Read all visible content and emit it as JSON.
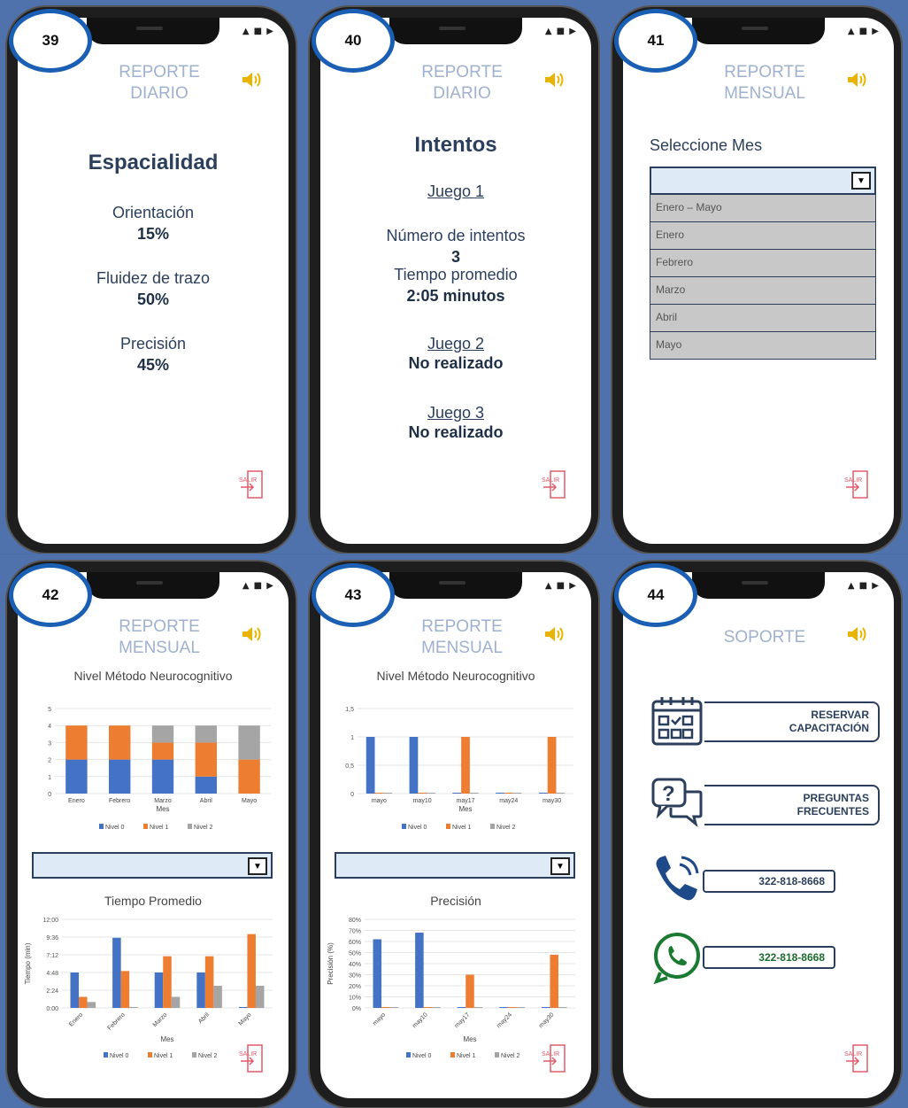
{
  "status_icons": "▲ ■ ▶",
  "panels": {
    "p39": {
      "number": "39",
      "title": "REPORTE DIARIO",
      "heading": "Espacialidad",
      "items": [
        {
          "label": "Orientación",
          "value": "15%"
        },
        {
          "label": "Fluidez de trazo",
          "value": "50%"
        },
        {
          "label": "Precisión",
          "value": "45%"
        }
      ]
    },
    "p40": {
      "number": "40",
      "title": "REPORTE DIARIO",
      "heading": "Intentos",
      "game1": "Juego 1",
      "attempts_label": "Número de intentos",
      "attempts_value": "3",
      "time_label": "Tiempo promedio",
      "time_value": "2:05 minutos",
      "game2": "Juego 2",
      "game2_status": "No realizado",
      "game3": "Juego 3",
      "game3_status": "No realizado"
    },
    "p41": {
      "number": "41",
      "title": "REPORTE MENSUAL",
      "select_label": "Seleccione Mes",
      "options": [
        "Enero – Mayo",
        "Enero",
        "Febrero",
        "Marzo",
        "Abril",
        "Mayo"
      ]
    },
    "p42": {
      "number": "42",
      "title": "REPORTE MENSUAL",
      "chart1_title": "Nivel Método Neurocognitivo",
      "chart2_title": "Tiempo Promedio"
    },
    "p43": {
      "number": "43",
      "title": "REPORTE MENSUAL",
      "chart1_title": "Nivel Método Neurocognitivo",
      "chart2_title": "Precisión"
    },
    "p44": {
      "number": "44",
      "title": "SOPORTE",
      "reserve": "RESERVAR CAPACITACIÓN",
      "faq": "PREGUNTAS FRECUENTES",
      "phone": "322-818-8668",
      "whatsapp": "322-818-8668"
    }
  },
  "exit_label": "SALIR",
  "colors": {
    "nivel0": "#4472c4",
    "nivel1": "#ed7d31",
    "nivel2": "#a5a5a5"
  },
  "chart_data": [
    {
      "type": "bar",
      "stacked": true,
      "title": "Nivel Método Neurocognitivo",
      "xlabel": "Mes",
      "categories": [
        "Enero",
        "Febrero",
        "Marzo",
        "Abril",
        "Mayo"
      ],
      "ylim": [
        0,
        5
      ],
      "yticks": [
        "0",
        "1",
        "2",
        "3",
        "4",
        "5"
      ],
      "series": [
        {
          "name": "Nivel 0",
          "values": [
            2,
            2,
            2,
            1,
            0
          ]
        },
        {
          "name": "Nivel 1",
          "values": [
            2,
            2,
            1,
            2,
            2
          ]
        },
        {
          "name": "Nivel 2",
          "values": [
            0,
            0,
            1,
            1,
            2
          ]
        }
      ]
    },
    {
      "type": "bar",
      "title": "Tiempo Promedio",
      "xlabel": "Mes",
      "ylabel": "Tiempo (min)",
      "categories": [
        "Enero",
        "Febrero",
        "Marzo",
        "Abril",
        "Mayo"
      ],
      "ylim": [
        0,
        12
      ],
      "yticks": [
        "0:00",
        "2:24",
        "4:48",
        "7:12",
        "9:36",
        "12:00"
      ],
      "series": [
        {
          "name": "Nivel 0",
          "values": [
            4.8,
            9.5,
            4.8,
            4.8,
            0
          ]
        },
        {
          "name": "Nivel 1",
          "values": [
            1.5,
            5,
            7,
            7,
            10
          ]
        },
        {
          "name": "Nivel 2",
          "values": [
            0.8,
            0,
            1.5,
            3,
            3
          ]
        }
      ]
    },
    {
      "type": "bar",
      "title": "Nivel Método Neurocognitivo",
      "xlabel": "Mes",
      "categories": [
        "mayo",
        "may10",
        "may17",
        "may24",
        "may30"
      ],
      "ylim": [
        0,
        1.5
      ],
      "yticks": [
        "0",
        "0,5",
        "1",
        "1,5"
      ],
      "series": [
        {
          "name": "Nivel 0",
          "values": [
            1,
            1,
            0,
            0,
            0
          ]
        },
        {
          "name": "Nivel 1",
          "values": [
            0,
            0,
            1,
            0,
            1
          ]
        },
        {
          "name": "Nivel 2",
          "values": [
            0,
            0,
            0,
            0,
            0
          ]
        }
      ]
    },
    {
      "type": "bar",
      "title": "Precisión",
      "xlabel": "Mes",
      "ylabel": "Precisión (%)",
      "categories": [
        "mayo",
        "may10",
        "may17",
        "may24",
        "may30"
      ],
      "ylim": [
        0,
        80
      ],
      "yticks": [
        "0%",
        "10%",
        "20%",
        "30%",
        "40%",
        "50%",
        "60%",
        "70%",
        "80%"
      ],
      "series": [
        {
          "name": "Nivel 0",
          "values": [
            62,
            68,
            0,
            0,
            0
          ]
        },
        {
          "name": "Nivel 1",
          "values": [
            0,
            0,
            30,
            0,
            48
          ]
        },
        {
          "name": "Nivel 2",
          "values": [
            0,
            0,
            0,
            0,
            0
          ]
        }
      ]
    }
  ]
}
